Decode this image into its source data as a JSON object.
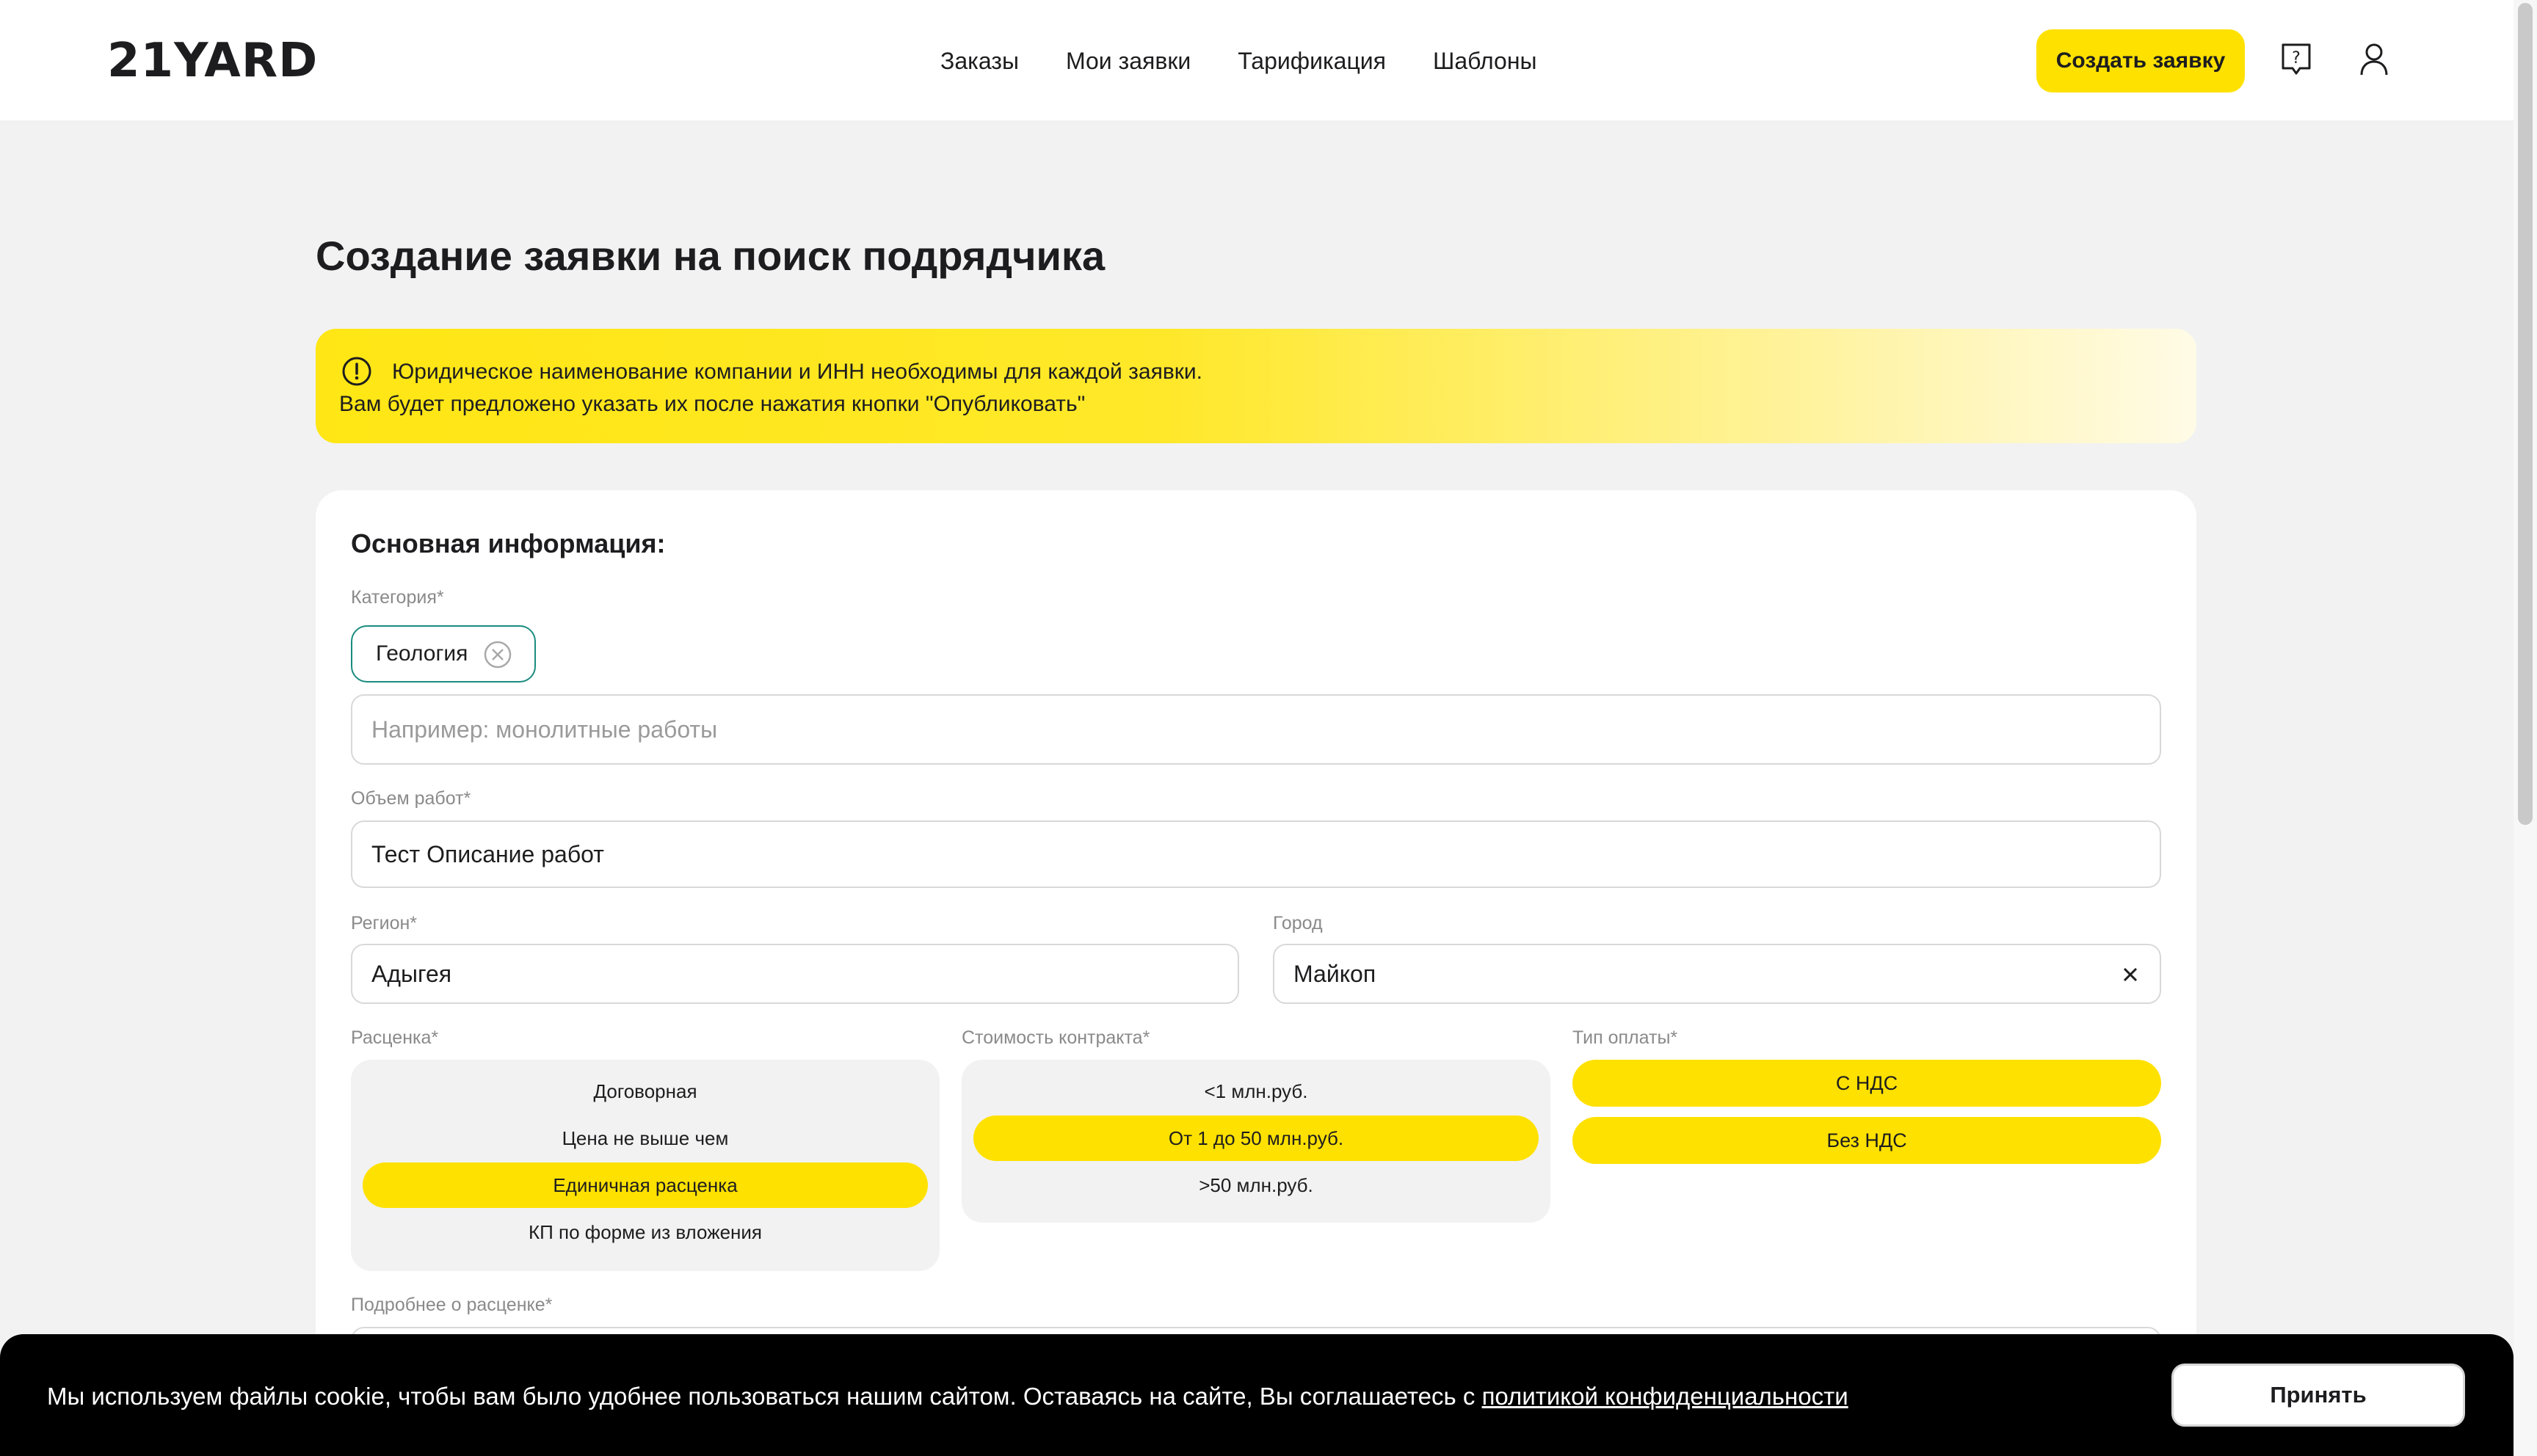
{
  "header": {
    "logo": "21YARD",
    "nav": [
      "Заказы",
      "Мои заявки",
      "Тарификация",
      "Шаблоны"
    ],
    "create_button": "Создать заявку",
    "help_icon": "question-bubble-icon",
    "user_icon": "user-icon"
  },
  "page_title": "Создание заявки на поиск подрядчика",
  "notice": {
    "icon": "exclamation-circle-icon",
    "line1": "Юридическое наименование компании и ИНН необходимы для каждой заявки.",
    "line2": "Вам будет предложено указать их после нажатия кнопки \"Опубликовать\""
  },
  "form": {
    "section_title": "Основная информация:",
    "category": {
      "label": "Категория*",
      "chip": "Геология",
      "placeholder": "Например: монолитные работы"
    },
    "volume": {
      "label": "Объем работ*",
      "value": "Тест Описание работ"
    },
    "region": {
      "label": "Регион*",
      "value": "Адыгея"
    },
    "city": {
      "label": "Город",
      "value": "Майкоп"
    },
    "pricing": {
      "label": "Расценка*",
      "options": [
        "Договорная",
        "Цена не выше чем",
        "Единичная расценка",
        "КП по форме из вложения"
      ],
      "selected": "Единичная расценка"
    },
    "contract_cost": {
      "label": "Стоимость контракта*",
      "options": [
        "<1 млн.руб.",
        "От 1 до 50 млн.руб.",
        ">50 млн.руб."
      ],
      "selected": "От 1 до 50 млн.руб."
    },
    "payment_type": {
      "label": "Тип оплаты*",
      "options": [
        "С НДС",
        "Без НДС"
      ]
    },
    "pricing_details": {
      "label": "Подробнее о расценке*"
    }
  },
  "cookie": {
    "text": "Мы используем файлы cookie, чтобы вам было удобнее пользоваться нашим сайтом. Оставаясь на сайте, Вы соглашаетесь с ",
    "link": "политикой конфиденциальности",
    "accept": "Принять"
  },
  "colors": {
    "accent": "#ffe100",
    "chip_border": "#1a8c80",
    "background": "#f2f2f2"
  }
}
